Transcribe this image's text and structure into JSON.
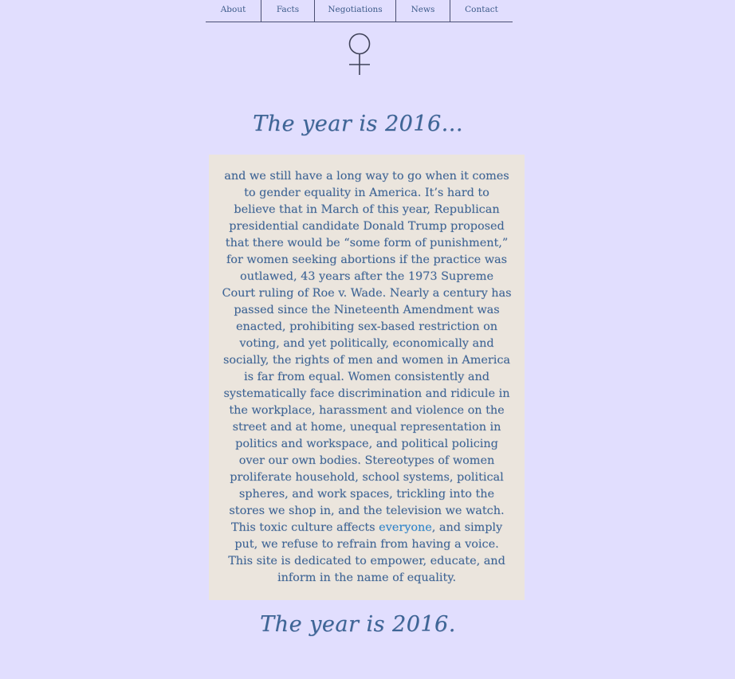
{
  "nav": {
    "items": [
      {
        "label": "About"
      },
      {
        "label": "Facts"
      },
      {
        "label": "Negotiations"
      },
      {
        "label": "News"
      },
      {
        "label": "Contact"
      }
    ]
  },
  "logo": {
    "icon": "venus-symbol-icon"
  },
  "main": {
    "heading_top": "The year is 2016...",
    "body_before_link": "and we still have a long way to go when it comes to gender equality in America. It’s hard to believe that in March of this year, Republican presidential candidate Donald Trump proposed that there would be “some form of punishment,” for women seeking abortions if the practice was outlawed, 43 years after the 1973 Supreme Court ruling of Roe v. Wade. Nearly a century has passed since the Nineteenth Amendment was enacted, prohibiting sex-based restriction on voting, and yet politically, economically and socially, the rights of men and women in America is far from equal. Women consistently and systematically face discrimination and ridicule in the workplace, harassment and violence on the street and at home, unequal representation in politics and workspace, and political policing over our own bodies. Stereotypes of women proliferate household, school systems, political spheres, and work spaces, trickling into the stores we shop in, and the television we watch. This toxic culture affects ",
    "link_text": "everyone",
    "body_after_link": ", and simply put, we refuse to refrain from having a voice. This site is dedicated to empower, educate, and inform in the name of equality.",
    "heading_bottom": "The year is 2016."
  },
  "colors": {
    "background": "#e1defe",
    "panel": "#ebe5dd",
    "text": "#3d6596",
    "link": "#2a86cf"
  }
}
